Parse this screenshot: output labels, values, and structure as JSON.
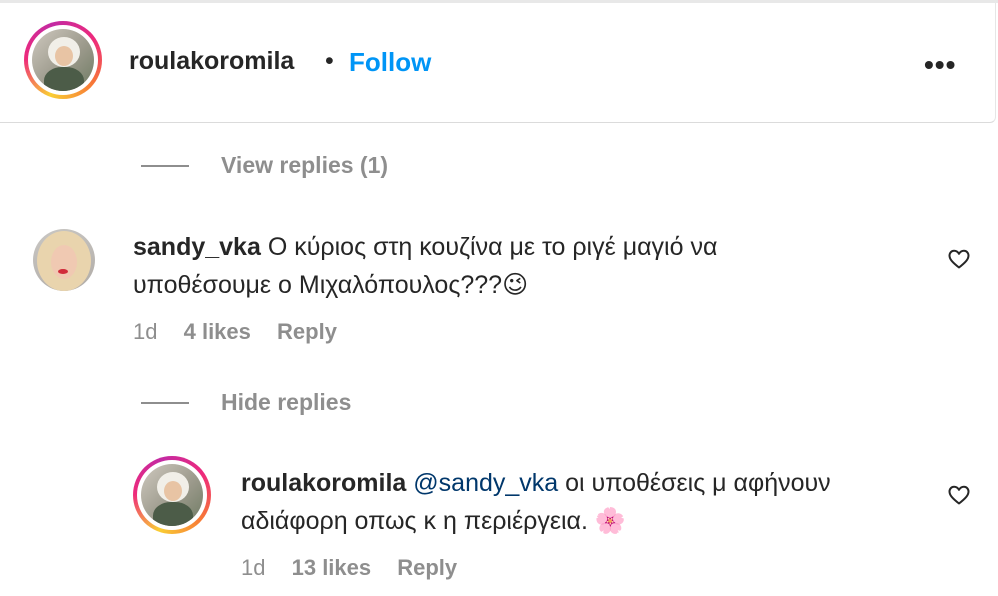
{
  "post_header": {
    "username": "roulakoromila",
    "separator": "•",
    "follow_label": "Follow",
    "more_label": "•••"
  },
  "replies_toggle_1": {
    "label": "View replies (1)"
  },
  "comment_1": {
    "username": "sandy_vka",
    "text_line1": "Ο κύριος στη κουζίνα με το ριγέ μαγιό να",
    "text_line2": "υποθέσουμε ο Μιχαλόπουλος???",
    "emoji": "😉",
    "time": "1d",
    "likes": "4 likes",
    "reply_label": "Reply"
  },
  "replies_toggle_2": {
    "label": "Hide replies"
  },
  "reply_1": {
    "username": "roulakoromila",
    "mention": "@sandy_vka",
    "text_line1": "οι υποθέσεις μ αφήνουν",
    "text_line2": "αδιάφορη οπως κ η περιέργεια.",
    "emoji": "🌸",
    "time": "1d",
    "likes": "13 likes",
    "reply_label": "Reply"
  },
  "colors": {
    "link_blue": "#0095f6",
    "mention_blue": "#00376b",
    "text_primary": "#262626",
    "text_secondary": "#8e8e8e"
  },
  "icons": [
    "more-options-icon",
    "heart-outline-icon"
  ]
}
